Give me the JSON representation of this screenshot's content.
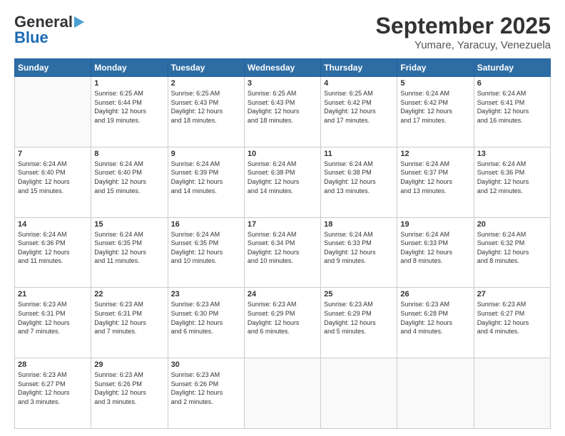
{
  "logo": {
    "line1": "General",
    "line2": "Blue"
  },
  "title": "September 2025",
  "subtitle": "Yumare, Yaracuy, Venezuela",
  "days_header": [
    "Sunday",
    "Monday",
    "Tuesday",
    "Wednesday",
    "Thursday",
    "Friday",
    "Saturday"
  ],
  "weeks": [
    [
      {
        "num": "",
        "info": ""
      },
      {
        "num": "1",
        "info": "Sunrise: 6:25 AM\nSunset: 6:44 PM\nDaylight: 12 hours\nand 19 minutes."
      },
      {
        "num": "2",
        "info": "Sunrise: 6:25 AM\nSunset: 6:43 PM\nDaylight: 12 hours\nand 18 minutes."
      },
      {
        "num": "3",
        "info": "Sunrise: 6:25 AM\nSunset: 6:43 PM\nDaylight: 12 hours\nand 18 minutes."
      },
      {
        "num": "4",
        "info": "Sunrise: 6:25 AM\nSunset: 6:42 PM\nDaylight: 12 hours\nand 17 minutes."
      },
      {
        "num": "5",
        "info": "Sunrise: 6:24 AM\nSunset: 6:42 PM\nDaylight: 12 hours\nand 17 minutes."
      },
      {
        "num": "6",
        "info": "Sunrise: 6:24 AM\nSunset: 6:41 PM\nDaylight: 12 hours\nand 16 minutes."
      }
    ],
    [
      {
        "num": "7",
        "info": "Sunrise: 6:24 AM\nSunset: 6:40 PM\nDaylight: 12 hours\nand 15 minutes."
      },
      {
        "num": "8",
        "info": "Sunrise: 6:24 AM\nSunset: 6:40 PM\nDaylight: 12 hours\nand 15 minutes."
      },
      {
        "num": "9",
        "info": "Sunrise: 6:24 AM\nSunset: 6:39 PM\nDaylight: 12 hours\nand 14 minutes."
      },
      {
        "num": "10",
        "info": "Sunrise: 6:24 AM\nSunset: 6:38 PM\nDaylight: 12 hours\nand 14 minutes."
      },
      {
        "num": "11",
        "info": "Sunrise: 6:24 AM\nSunset: 6:38 PM\nDaylight: 12 hours\nand 13 minutes."
      },
      {
        "num": "12",
        "info": "Sunrise: 6:24 AM\nSunset: 6:37 PM\nDaylight: 12 hours\nand 13 minutes."
      },
      {
        "num": "13",
        "info": "Sunrise: 6:24 AM\nSunset: 6:36 PM\nDaylight: 12 hours\nand 12 minutes."
      }
    ],
    [
      {
        "num": "14",
        "info": "Sunrise: 6:24 AM\nSunset: 6:36 PM\nDaylight: 12 hours\nand 11 minutes."
      },
      {
        "num": "15",
        "info": "Sunrise: 6:24 AM\nSunset: 6:35 PM\nDaylight: 12 hours\nand 11 minutes."
      },
      {
        "num": "16",
        "info": "Sunrise: 6:24 AM\nSunset: 6:35 PM\nDaylight: 12 hours\nand 10 minutes."
      },
      {
        "num": "17",
        "info": "Sunrise: 6:24 AM\nSunset: 6:34 PM\nDaylight: 12 hours\nand 10 minutes."
      },
      {
        "num": "18",
        "info": "Sunrise: 6:24 AM\nSunset: 6:33 PM\nDaylight: 12 hours\nand 9 minutes."
      },
      {
        "num": "19",
        "info": "Sunrise: 6:24 AM\nSunset: 6:33 PM\nDaylight: 12 hours\nand 8 minutes."
      },
      {
        "num": "20",
        "info": "Sunrise: 6:24 AM\nSunset: 6:32 PM\nDaylight: 12 hours\nand 8 minutes."
      }
    ],
    [
      {
        "num": "21",
        "info": "Sunrise: 6:23 AM\nSunset: 6:31 PM\nDaylight: 12 hours\nand 7 minutes."
      },
      {
        "num": "22",
        "info": "Sunrise: 6:23 AM\nSunset: 6:31 PM\nDaylight: 12 hours\nand 7 minutes."
      },
      {
        "num": "23",
        "info": "Sunrise: 6:23 AM\nSunset: 6:30 PM\nDaylight: 12 hours\nand 6 minutes."
      },
      {
        "num": "24",
        "info": "Sunrise: 6:23 AM\nSunset: 6:29 PM\nDaylight: 12 hours\nand 6 minutes."
      },
      {
        "num": "25",
        "info": "Sunrise: 6:23 AM\nSunset: 6:29 PM\nDaylight: 12 hours\nand 5 minutes."
      },
      {
        "num": "26",
        "info": "Sunrise: 6:23 AM\nSunset: 6:28 PM\nDaylight: 12 hours\nand 4 minutes."
      },
      {
        "num": "27",
        "info": "Sunrise: 6:23 AM\nSunset: 6:27 PM\nDaylight: 12 hours\nand 4 minutes."
      }
    ],
    [
      {
        "num": "28",
        "info": "Sunrise: 6:23 AM\nSunset: 6:27 PM\nDaylight: 12 hours\nand 3 minutes."
      },
      {
        "num": "29",
        "info": "Sunrise: 6:23 AM\nSunset: 6:26 PM\nDaylight: 12 hours\nand 3 minutes."
      },
      {
        "num": "30",
        "info": "Sunrise: 6:23 AM\nSunset: 6:26 PM\nDaylight: 12 hours\nand 2 minutes."
      },
      {
        "num": "",
        "info": ""
      },
      {
        "num": "",
        "info": ""
      },
      {
        "num": "",
        "info": ""
      },
      {
        "num": "",
        "info": ""
      }
    ]
  ]
}
